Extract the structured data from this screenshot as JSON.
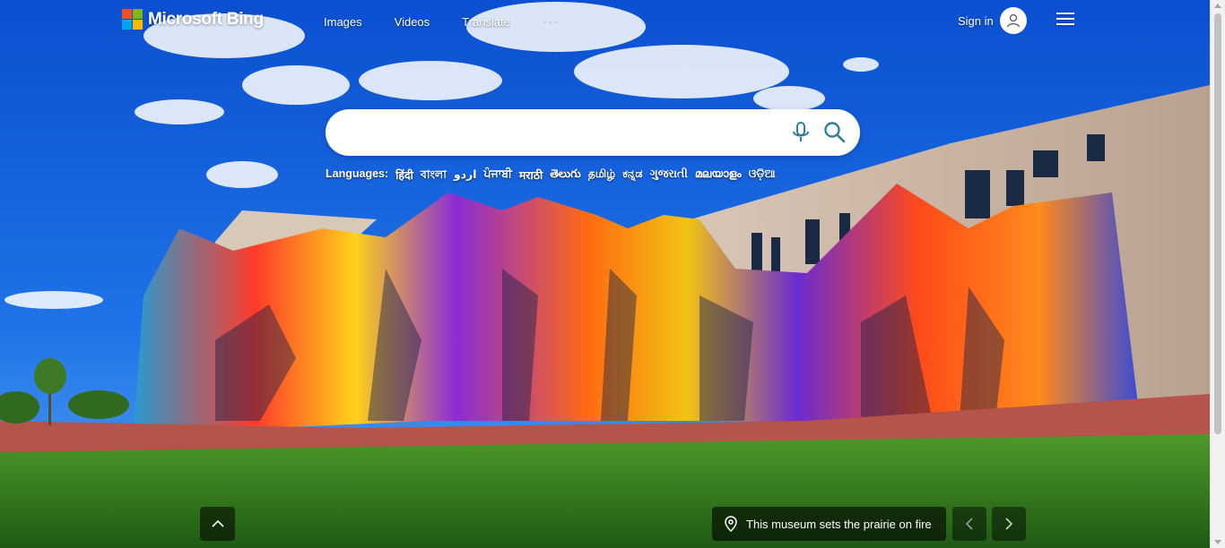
{
  "brand": {
    "name": "Microsoft Bing",
    "tile_colors": [
      "#f25022",
      "#7fba00",
      "#00a4ef",
      "#ffb900"
    ]
  },
  "nav": {
    "items": [
      {
        "label": "Images"
      },
      {
        "label": "Videos"
      },
      {
        "label": "Translate"
      }
    ],
    "more": "···"
  },
  "account": {
    "signin_label": "Sign in",
    "avatar_icon": "person-icon",
    "menu_icon": "hamburger-menu-icon"
  },
  "search": {
    "value": "",
    "placeholder": "",
    "mic_icon": "microphone-icon",
    "search_icon": "search-icon",
    "accent": "#2f7d9a"
  },
  "languages": {
    "lead": "Languages:",
    "items": [
      "हिंदी",
      "বাংলা",
      "اردو",
      "ਪੰਜਾਬੀ",
      "मराठी",
      "తెలుగు",
      "தமிழ்",
      "ಕನ್ನಡ",
      "ગુજરાતી",
      "മലയാളം",
      "ଓଡ଼ିଆ"
    ]
  },
  "footer": {
    "scroll_up_icon": "chevron-up-icon",
    "caption": "This museum sets the prairie on fire",
    "location_icon": "location-pin-icon",
    "prev_icon": "chevron-left-icon",
    "next_icon": "chevron-right-icon"
  }
}
